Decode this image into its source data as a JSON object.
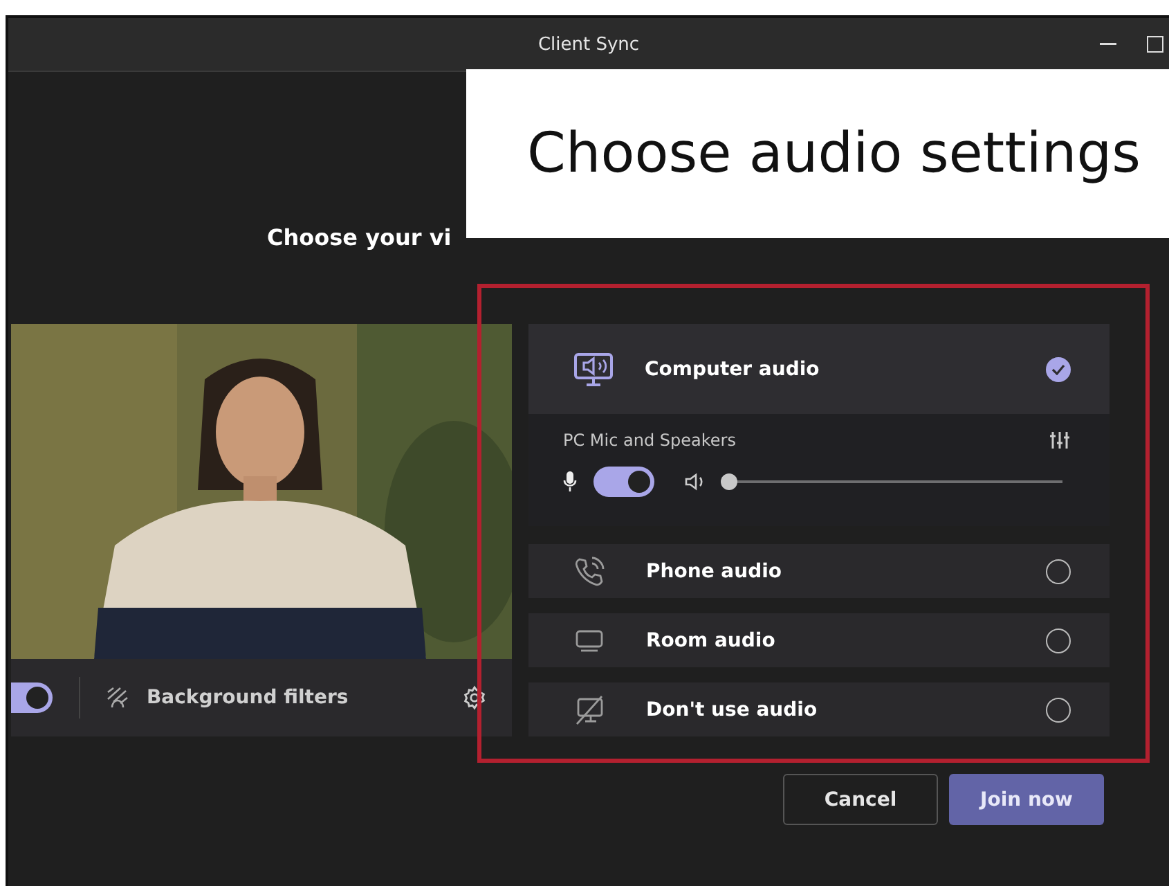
{
  "window": {
    "title": "Client Sync"
  },
  "callout": {
    "text": "Choose audio settings"
  },
  "heading": "Choose your vi",
  "video": {
    "kind": "picture",
    "camera_on": true,
    "filters_label": "Background filters"
  },
  "audio_options": [
    {
      "kind": "device",
      "label": "Computer audio",
      "selected": true,
      "device": {
        "label": "PC Mic and Speakers",
        "mic_on": true,
        "volume": {
          "level": 0.0
        }
      }
    },
    {
      "kind": "phone",
      "label": "Phone audio",
      "selected": false
    },
    {
      "kind": "room",
      "label": "Room audio",
      "selected": false
    },
    {
      "kind": "none",
      "label": "Don't use audio",
      "selected": false
    }
  ],
  "buttons": [
    {
      "kind": "secondary",
      "label": "Cancel"
    },
    {
      "kind": "primary",
      "label": "Join now"
    }
  ]
}
